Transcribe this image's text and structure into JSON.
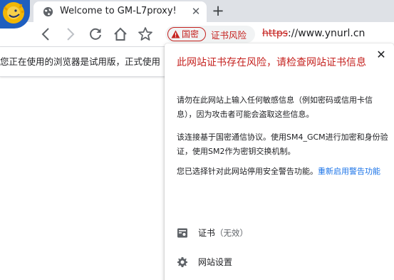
{
  "tab": {
    "title": "Welcome to GM-L7proxy!",
    "close_glyph": "✕",
    "favicon": "globe-icon"
  },
  "new_tab_glyph": "+",
  "toolbar": {
    "back": "arrow-left-icon",
    "forward": "arrow-right-icon",
    "reload": "reload-icon",
    "home": "home-icon",
    "bookmark": "star-icon"
  },
  "omnibox": {
    "badge_label": "国密",
    "risk_label": "证书风险",
    "url_scheme": "https",
    "url_rest": "://www.ynurl.cn"
  },
  "infobar": {
    "text": "您正在使用的浏览器是试用版，正式使用"
  },
  "popup": {
    "close_glyph": "✕",
    "heading": "此网站证书存在风险，请检查网站证书信息",
    "para1": "请勿在此网站上输入任何敏感信息（例如密码或信用卡信息），因为攻击者可能会盗取这些信息。",
    "para2": "该连接基于国密通信协议。使用SM4_GCM进行加密和身份验证，使用SM2作为密钥交换机制。",
    "para3_text": "您已选择针对此网站停用安全警告功能。",
    "para3_link": "重新启用警告功能",
    "cert_label": "证书",
    "cert_status": "（无效）",
    "site_settings_label": "网站设置"
  },
  "colors": {
    "warning": "#c5221f",
    "link": "#1a73e8",
    "tabstrip": "#dee1e6"
  }
}
